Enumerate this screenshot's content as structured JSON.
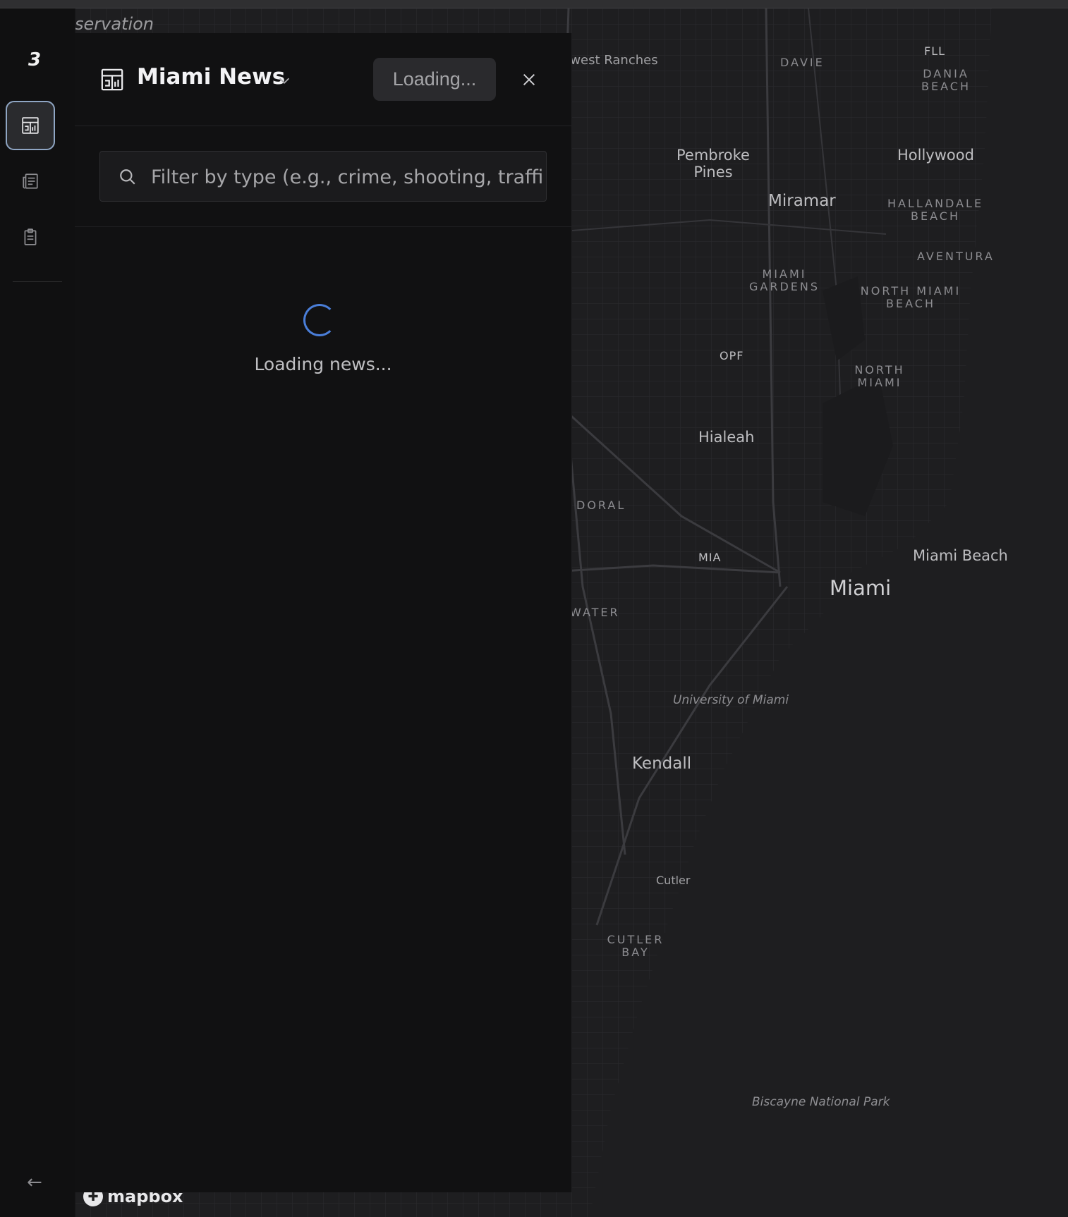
{
  "map": {
    "labels": {
      "southwest_ranches": "Southwest Ranches",
      "davie": "DAVIE",
      "fll": "FLL",
      "dania_beach": "DANIA BEACH",
      "pembroke_pines": "Pembroke Pines",
      "hollywood": "Hollywood",
      "miramar": "Miramar",
      "hallandale_beach": "HALLANDALE BEACH",
      "aventura": "AVENTURA",
      "miami_gardens": "MIAMI GARDENS",
      "north_miami_beach": "NORTH MIAMI BEACH",
      "opf": "OPF",
      "north_miami": "NORTH MIAMI",
      "hialeah": "Hialeah",
      "doral": "DORAL",
      "mia": "MIA",
      "miami_beach": "Miami Beach",
      "miami": "Miami",
      "water": "WATER",
      "university_of_miami": "University of Miami",
      "kendall": "Kendall",
      "cutler": "Cutler",
      "cutler_bay": "CUTLER BAY",
      "biscayne_national_park": "Biscayne National Park"
    },
    "partial_label": "servation",
    "attribution": "mapbox"
  },
  "sidebar": {
    "logo": "3"
  },
  "panel": {
    "title": "Miami News",
    "loading_button": "Loading...",
    "filter_placeholder": "Filter by type (e.g., crime, shooting, traffic,",
    "loading_text": "Loading news..."
  },
  "colors": {
    "accent": "#4a7ed8",
    "active_border": "#8fa6c4"
  }
}
